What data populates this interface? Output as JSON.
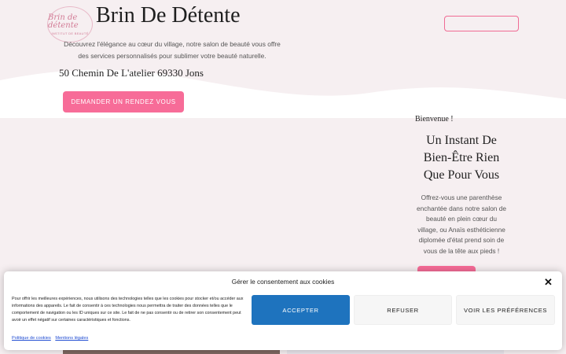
{
  "header": {
    "logo_text": "Brin de détente",
    "logo_subtext": "INSTITUT DE BEAUTÉ",
    "site_title": "Brin De Détente"
  },
  "hero": {
    "description": "Découvrez l'élégance au cœur du village, notre salon de beauté vous offre des services personnalisés pour sublimer votre beauté naturelle.",
    "address": "50 Chemin De L'atelier 69330 Jons",
    "cta_label": "DEMANDER UN RENDEZ VOUS"
  },
  "welcome": {
    "eyebrow": "Bienvenue !",
    "headline": "Un Instant De Bien-Être Rien Que Pour Vous",
    "body": "Offrez-vous une parenthèse enchantée dans notre salon de beauté en plein cœur du village, ou Anaïs esthéticienne diplomée d'état prend soin de vous de la tête aux pieds !"
  },
  "cookie_banner": {
    "title": "Gérer le consentement aux cookies",
    "body": "Pour offrir les meilleures expériences, nous utilisons des technologies telles que les cookies pour stocker et/ou accéder aux informations des appareils. Le fait de consentir à ces technologies nous permettra de traiter des données telles que le comportement de navigation ou les ID uniques sur ce site. Le fait de ne pas consentir ou de retirer son consentement peut avoir un effet négatif sur certaines caractéristiques et fonctions.",
    "accept_label": "ACCEPTER",
    "refuse_label": "REFUSER",
    "prefs_label": "VOIR LES PRÉFÉRENCES",
    "close_icon": "close-icon",
    "links": [
      "Politique de cookies",
      "Mentions légales"
    ]
  },
  "colors": {
    "accent_pink": "#f76c98",
    "accept_blue": "#1e73be",
    "background": "#f6eff1"
  }
}
